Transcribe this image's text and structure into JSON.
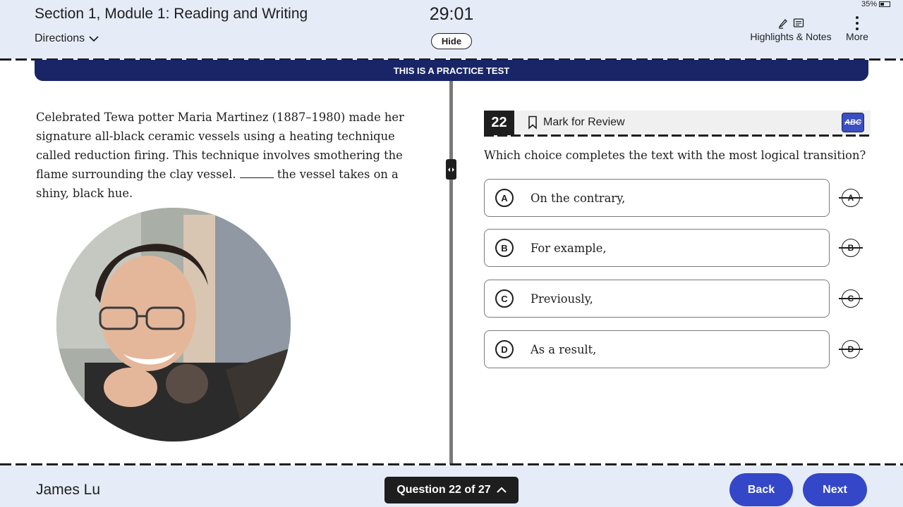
{
  "header": {
    "section_title": "Section 1, Module 1: Reading and Writing",
    "directions_label": "Directions",
    "timer": "29:01",
    "hide_label": "Hide",
    "battery": "35%",
    "highlights_label": "Highlights & Notes",
    "more_label": "More"
  },
  "banner": {
    "text": "THIS IS A PRACTICE TEST"
  },
  "passage": {
    "before_blank": "Celebrated Tewa potter Maria Martinez (1887–1980) made her signature all-black ceramic vessels using a heating technique called reduction firing. This technique involves smothering the flame surrounding the clay vessel.",
    "after_blank": "the vessel takes on a shiny, black hue."
  },
  "question": {
    "number": "22",
    "mark_label": "Mark for Review",
    "abc_label": "ABC",
    "prompt": "Which choice completes the text with the most logical transition?",
    "choices": [
      {
        "letter": "A",
        "text": "On the contrary,"
      },
      {
        "letter": "B",
        "text": "For example,"
      },
      {
        "letter": "C",
        "text": "Previously,"
      },
      {
        "letter": "D",
        "text": "As a result,"
      }
    ]
  },
  "footer": {
    "student_name": "James Lu",
    "question_nav": "Question 22 of 27",
    "back_label": "Back",
    "next_label": "Next"
  },
  "colors": {
    "header_bg": "#e6ecf7",
    "banner_bg": "#1a2567",
    "button_blue": "#3447c9",
    "dark": "#1e1e1e"
  }
}
